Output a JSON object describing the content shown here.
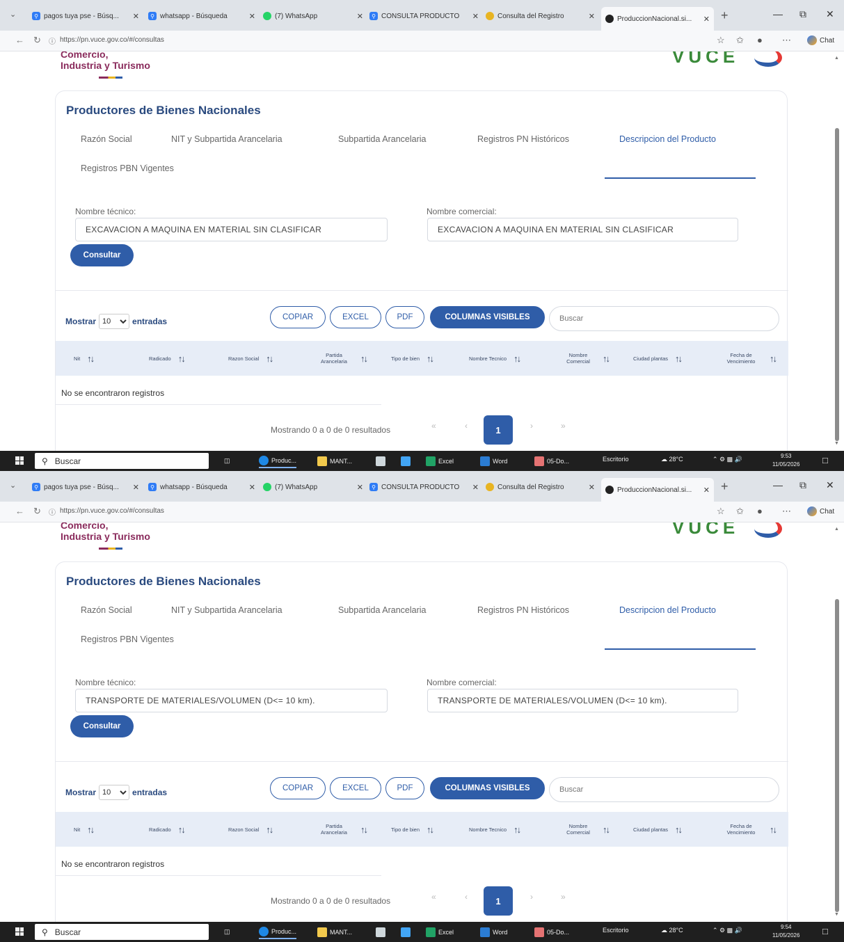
{
  "screenshots": [
    {
      "browser": {
        "tabs": [
          {
            "title": "pagos tuya pse - Búsq..."
          },
          {
            "title": "whatsapp - Búsqueda"
          },
          {
            "title": "(7) WhatsApp"
          },
          {
            "title": "CONSULTA PRODUCTO"
          },
          {
            "title": "Consulta del Registro"
          },
          {
            "title": "ProduccionNacional.si..."
          }
        ],
        "url": "https://pn.vuce.gov.co/#/consultas",
        "chat_label": "Chat"
      },
      "header": {
        "ministry_line1": "Comercio,",
        "ministry_line2": "Industria y Turismo",
        "logo_text": "VUCE"
      },
      "card": {
        "title": "Productores de Bienes Nacionales",
        "tabs": [
          {
            "label": "Razón Social"
          },
          {
            "label": "NIT y Subpartida Arancelaria"
          },
          {
            "label": "Subpartida Arancelaria"
          },
          {
            "label": "Registros PN Históricos"
          },
          {
            "label": "Descripcion del Producto"
          },
          {
            "label": "Registros PBN Vigentes"
          }
        ],
        "active_tab": "Descripcion del Producto",
        "nombre_tecnico_label": "Nombre técnico:",
        "nombre_tecnico_value": "EXCAVACION A MAQUINA EN MATERIAL SIN CLASIFICAR",
        "nombre_comercial_label": "Nombre comercial:",
        "nombre_comercial_value": "EXCAVACION A MAQUINA EN MATERIAL SIN CLASIFICAR",
        "consultar_label": "Consultar"
      },
      "table": {
        "mostrar_label": "Mostrar",
        "entries_value": "10",
        "entradas_label": "entradas",
        "buttons": {
          "copiar": "COPIAR",
          "excel": "EXCEL",
          "pdf": "PDF",
          "columnas": "COLUMNAS VISIBLES"
        },
        "search_placeholder": "Buscar",
        "columns": [
          "Nit",
          "Radicado",
          "Razon Social",
          "Partida Arancelaria",
          "Tipo de bien",
          "Nombre Tecnico",
          "Nombre Comercial",
          "Ciudad plantas",
          "Fecha de Vencimiento"
        ],
        "empty_text": "No se encontraron registros",
        "info_text": "Mostrando 0 a 0 de 0 resultados",
        "pager": {
          "first": "«",
          "prev": "‹",
          "current": "1",
          "next": "›",
          "last": "»"
        }
      },
      "taskbar": {
        "search_label": "Buscar",
        "apps": [
          {
            "label": "Produc..."
          },
          {
            "label": "MANT..."
          },
          {
            "label": "Excel"
          },
          {
            "label": "Word"
          },
          {
            "label": "05-Do..."
          }
        ],
        "desktop_label": "Escritorio",
        "weather": "28°C",
        "time": "9:53",
        "date": "11/05/2026"
      }
    },
    {
      "browser": {
        "tabs": [
          {
            "title": "pagos tuya pse - Búsq..."
          },
          {
            "title": "whatsapp - Búsqueda"
          },
          {
            "title": "(7) WhatsApp"
          },
          {
            "title": "CONSULTA PRODUCTO"
          },
          {
            "title": "Consulta del Registro"
          },
          {
            "title": "ProduccionNacional.si..."
          }
        ],
        "url": "https://pn.vuce.gov.co/#/consultas",
        "chat_label": "Chat"
      },
      "header": {
        "ministry_line1": "Comercio,",
        "ministry_line2": "Industria y Turismo",
        "logo_text": "VUCE"
      },
      "card": {
        "title": "Productores de Bienes Nacionales",
        "tabs": [
          {
            "label": "Razón Social"
          },
          {
            "label": "NIT y Subpartida Arancelaria"
          },
          {
            "label": "Subpartida Arancelaria"
          },
          {
            "label": "Registros PN Históricos"
          },
          {
            "label": "Descripcion del Producto"
          },
          {
            "label": "Registros PBN Vigentes"
          }
        ],
        "active_tab": "Descripcion del Producto",
        "nombre_tecnico_label": "Nombre técnico:",
        "nombre_tecnico_value": "TRANSPORTE DE MATERIALES/VOLUMEN (D<= 10 km).",
        "nombre_comercial_label": "Nombre comercial:",
        "nombre_comercial_value": "TRANSPORTE DE MATERIALES/VOLUMEN (D<= 10 km).",
        "consultar_label": "Consultar"
      },
      "table": {
        "mostrar_label": "Mostrar",
        "entries_value": "10",
        "entradas_label": "entradas",
        "buttons": {
          "copiar": "COPIAR",
          "excel": "EXCEL",
          "pdf": "PDF",
          "columnas": "COLUMNAS VISIBLES"
        },
        "search_placeholder": "Buscar",
        "columns": [
          "Nit",
          "Radicado",
          "Razon Social",
          "Partida Arancelaria",
          "Tipo de bien",
          "Nombre Tecnico",
          "Nombre Comercial",
          "Ciudad plantas",
          "Fecha de Vencimiento"
        ],
        "empty_text": "No se encontraron registros",
        "info_text": "Mostrando 0 a 0 de 0 resultados",
        "pager": {
          "first": "«",
          "prev": "‹",
          "current": "1",
          "next": "›",
          "last": "»"
        }
      },
      "taskbar": {
        "search_label": "Buscar",
        "apps": [
          {
            "label": "Produc..."
          },
          {
            "label": "MANT..."
          },
          {
            "label": "Excel"
          },
          {
            "label": "Word"
          },
          {
            "label": "05-Do..."
          }
        ],
        "desktop_label": "Escritorio",
        "weather": "28°C",
        "time": "9:54",
        "date": "11/05/2026"
      }
    }
  ],
  "colors": {
    "primary": "#2f5da8",
    "title": "#2a4a7f",
    "ministry": "#8a2b5c",
    "table_header_bg": "#e7edf7"
  },
  "icons": [
    "search-icon",
    "refresh-icon",
    "back-icon",
    "star-icon",
    "favorites-icon",
    "windows-start-icon",
    "sort-icon"
  ]
}
